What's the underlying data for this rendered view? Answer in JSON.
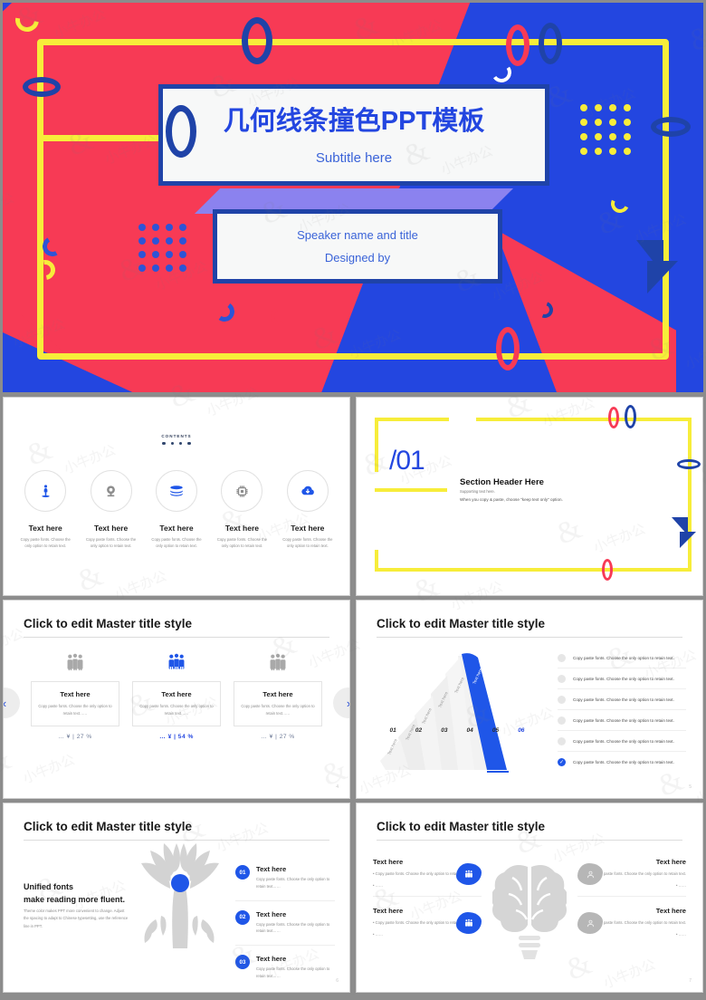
{
  "theme": {
    "blue": "#2346e0",
    "red": "#f73a55",
    "yellow": "#f7ed3a",
    "dark_blue": "#1f43a8",
    "purple": "#8b82ef",
    "gray": "#b6b6b6"
  },
  "cover": {
    "title": "几何线条撞色PPT模板",
    "subtitle": "Subtitle here",
    "speaker": "Speaker name and title",
    "designed_by": "Designed by"
  },
  "contents": {
    "label": "CONTENTS",
    "dot_count": 4,
    "items": [
      {
        "icon": "person-meditate-icon",
        "name": "Text here",
        "desc": "Copy paste fonts. Choose the only option to retain text."
      },
      {
        "icon": "webcam-icon",
        "name": "Text here",
        "desc": "Copy paste fonts. Choose the only option to retain text."
      },
      {
        "icon": "layers-icon",
        "name": "Text here",
        "desc": "Copy paste fonts. Choose the only option to retain text."
      },
      {
        "icon": "cpu-chip-icon",
        "name": "Text here",
        "desc": "Copy paste fonts. Choose the only option to retain text."
      },
      {
        "icon": "cloud-download-icon",
        "name": "Text here",
        "desc": "Copy paste fonts. Choose the only option to retain text."
      }
    ]
  },
  "section": {
    "number": "/01",
    "header": "Section Header Here",
    "support": "Supporting text here.",
    "note": "When you copy & paste, choose \"keep text only\" option."
  },
  "slide_cards": {
    "title": "Click to edit Master title style",
    "prev_icon": "chevron-left-icon",
    "next_icon": "chevron-right-icon",
    "page": "4",
    "cards": [
      {
        "icon": "people-group-icon",
        "heading": "Text here",
        "desc": "Copy paste fonts. Choose the only option to retain text……",
        "stat": "…  ¥  |  27 %",
        "highlight": false
      },
      {
        "icon": "people-group-icon",
        "heading": "Text here",
        "desc": "Copy paste fonts. Choose the only option to retain text……",
        "stat": "…  ¥  |  54 %",
        "highlight": true
      },
      {
        "icon": "people-group-icon",
        "heading": "Text here",
        "desc": "Copy paste fonts. Choose the only option to retain text……",
        "stat": "…  ¥  |  27 %",
        "highlight": false
      }
    ]
  },
  "slide_pyramid": {
    "title": "Click to edit Master title style",
    "page": "5",
    "segment_label": "Text here",
    "axis": [
      "01",
      "02",
      "03",
      "04",
      "05",
      "06"
    ],
    "active_index": 5,
    "list": [
      {
        "text": "Copy paste fonts. Choose the only option to retain text.",
        "active": false
      },
      {
        "text": "Copy paste fonts. Choose the only option to retain text.",
        "active": false
      },
      {
        "text": "Copy paste fonts. Choose the only option to retain text.",
        "active": false
      },
      {
        "text": "Copy paste fonts. Choose the only option to retain text.",
        "active": false
      },
      {
        "text": "Copy paste fonts. Choose the only option to retain text.",
        "active": false
      },
      {
        "text": "Copy paste fonts. Choose the only option to retain text.",
        "active": true
      }
    ]
  },
  "slide_tree": {
    "title": "Click to edit Master title style",
    "page": "6",
    "lead_line1": "Unified fonts",
    "lead_line2": "make reading more fluent.",
    "lead_body": "Theme color makes PPT more convenient to change. Adjust the spacing to adapt to Chinese typesetting, use the reference line in PPT.",
    "steps": [
      {
        "num": "01",
        "heading": "Text here",
        "desc": "Copy paste fonts. Choose the only option to retain text……"
      },
      {
        "num": "02",
        "heading": "Text here",
        "desc": "Copy paste fonts. Choose the only option to retain text……"
      },
      {
        "num": "03",
        "heading": "Text here",
        "desc": "Copy paste fonts. Choose the only option to retain text……"
      }
    ]
  },
  "slide_brain": {
    "title": "Click to edit Master title style",
    "page": "7",
    "quadrants": [
      {
        "side": "left",
        "icon": "people-group-icon",
        "icon_color": "blue",
        "heading": "Text here",
        "bullet1": "Copy paste fonts. Choose the only option to retain text.",
        "bullet2": "……"
      },
      {
        "side": "left",
        "icon": "people-group-icon",
        "icon_color": "blue",
        "heading": "Text here",
        "bullet1": "Copy paste fonts. Choose the only option to retain text.",
        "bullet2": "……"
      },
      {
        "side": "right",
        "icon": "user-avatar-icon",
        "icon_color": "gray",
        "heading": "Text here",
        "bullet1": "Copy paste fonts. Choose the only option to retain text.",
        "bullet2": "……"
      },
      {
        "side": "right",
        "icon": "user-avatar-icon",
        "icon_color": "gray",
        "heading": "Text here",
        "bullet1": "Copy paste fonts. Choose the only option to retain text.",
        "bullet2": "……"
      }
    ]
  }
}
